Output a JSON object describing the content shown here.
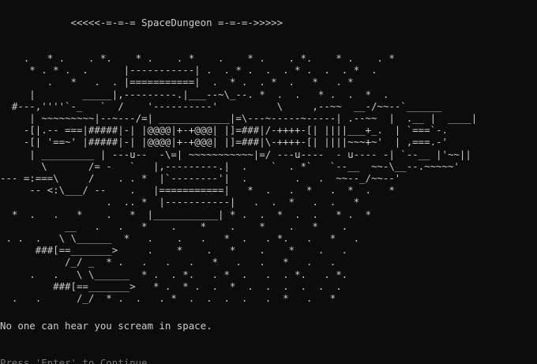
{
  "console": {
    "title": "            <<<<<-=-=-= SpaceDungeon =-=-=->>>>>",
    "art_lines": [
      "    .   * .    . *.    * .    . *    .    * .    . *.    * .    . *",
      "     * . * .  .      |-----------| .  . * .  .  . * .  .  . *  .",
      "        .   *   .  . |===========|  .  * .  . *  .   *   . *",
      "     |        _____|,---------.|___--~\\_--. *  .  .   * .  .  *  .",
      "  #---,''''`-_   `  /    '----------'          \\     ,--~~  __-/~~--`______",
      "     | ~~~~~~~~~|--~---/=| ____________|=\\---~-----~-----| .--~~  |  .__ |  ____|",
      "    -[|.-- ===|#####|-| |@@@@|+-+@@@| |]=###|/-++++-[| ||||___+_.  | `===`-.",
      "    -[| '==~' |#####|-| |@@@@|+-+@@@| |]=###|\\-++++-[| ||||~~~+~'  | ,===.-'",
      "     | _________ | ---u--  -\\=| ~~~~~~~~~~~|=/ ---u----  - u---- -| `--__ |'~~||",
      "       \\       /= -   `   |,---------.|  .    `  . *`   `--__  ~~-\\__--.~~~~~'",
      "--- =:===\\     /    . . *  |`--------'|  .        .   .  ~~--_/~~--'",
      "     -- <:\\___/ --    .   |===========|   *  .   .  *   .  *  .   *",
      "                  .  .. *  |-----------|   .  .  *   .  .   *",
      "  *  .   .   *    .   *  |___________| * .  .  *  .  .   * .  *",
      "           __   .   .   *    .    *    .    *    .   *    .",
      " . .  .   \\ \\______  *   .    .   .   *  .   . *.   .   *   .",
      "      ###[==_______>     .    *    .   *    .    *    .   .",
      "           /_/ _  * .   .   .   .   *   .   .   *   .   .",
      "     .   .   \\ \\______  * .  . *.   . *  .   .  . *.   . *.",
      "         ###[==_______>   * .  * .  .  *  .  .  .  .  .  .",
      "  .   .      /_/  * .  .   . *  .  .  .  .   .  *   .   *"
    ],
    "message": "No one can hear you scream in space.",
    "prompt": "Press 'Enter' to Continue"
  }
}
